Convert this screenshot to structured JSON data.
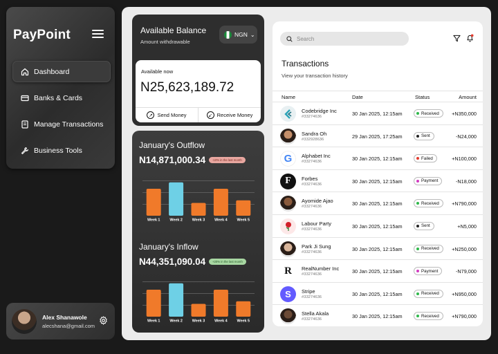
{
  "sidebar": {
    "brand": "PayPoint",
    "items": [
      {
        "label": "Dashboard",
        "icon": "home-icon"
      },
      {
        "label": "Banks & Cards",
        "icon": "card-icon"
      },
      {
        "label": "Manage Transactions",
        "icon": "receipt-icon"
      },
      {
        "label": "Business Tools",
        "icon": "wrench-icon"
      }
    ]
  },
  "profile": {
    "name": "Alex Shanawole",
    "email": "alecshana@gmail.com"
  },
  "balance": {
    "title": "Available Balance",
    "subtitle": "Amount withdrawable",
    "currency": "NGN",
    "available_label": "Available now",
    "amount": "N25,623,189.72",
    "send_label": "Send Money",
    "receive_label": "Receive Money"
  },
  "outflow": {
    "title": "January's Outflow",
    "amount": "N14,871,000.34",
    "badge": "-10% in the last month"
  },
  "inflow": {
    "title": "January's Inflow",
    "amount": "N44,351,090.04",
    "badge": "+20% in the last month"
  },
  "chart_data": [
    {
      "type": "bar",
      "categories": [
        "Week 1",
        "Week 2",
        "Week 3",
        "Week 4",
        "Week 5"
      ],
      "values": [
        42,
        52,
        20,
        42,
        24
      ],
      "highlight_index": 1,
      "colors": {
        "bar": "#f07a2a",
        "highlight": "#6ed0e6"
      }
    },
    {
      "type": "bar",
      "categories": [
        "Week 1",
        "Week 2",
        "Week 3",
        "Week 4",
        "Week 5"
      ],
      "values": [
        42,
        52,
        20,
        42,
        24
      ],
      "highlight_index": 1,
      "colors": {
        "bar": "#f07a2a",
        "highlight": "#6ed0e6"
      }
    }
  ],
  "transactions": {
    "search_placeholder": "Search",
    "title": "Transactions",
    "subtitle": "View your transaction history",
    "columns": [
      "Name",
      "Date",
      "Status",
      "Amount"
    ],
    "rows": [
      {
        "name": "Codebridge Inc",
        "id": "#33274636",
        "date": "30 Jan 2025, 12:15am",
        "status": "Received",
        "amount": "+N350,000",
        "logo": "codebridge-logo"
      },
      {
        "name": "Sandra Oh",
        "id": "#332928636",
        "date": "29 Jan 2025, 17:25am",
        "status": "Sent",
        "amount": "-N24,000",
        "logo": "avatar"
      },
      {
        "name": "Alphabet Inc",
        "id": "#33274636",
        "date": "30 Jan 2025, 12:15am",
        "status": "Failed",
        "amount": "+N100,000",
        "logo": "google-logo"
      },
      {
        "name": "Forbes",
        "id": "#33274636",
        "date": "30 Jan 2025, 12:15am",
        "status": "Payment",
        "amount": "-N18,000",
        "logo": "forbes-logo"
      },
      {
        "name": "Ayomide Ajao",
        "id": "#33274636",
        "date": "30 Jan 2025, 12:15am",
        "status": "Received",
        "amount": "+N790,000",
        "logo": "avatar"
      },
      {
        "name": "Labour Party",
        "id": "#33274636",
        "date": "30 Jan 2025, 12:15am",
        "status": "Sent",
        "amount": "+N5,000",
        "logo": "rose-logo"
      },
      {
        "name": "Park Ji Sung",
        "id": "#33274636",
        "date": "30 Jan 2025, 12:15am",
        "status": "Received",
        "amount": "+N250,000",
        "logo": "avatar"
      },
      {
        "name": "RealNumber Inc",
        "id": "#33274636",
        "date": "30 Jan 2025, 12:15am",
        "status": "Payment",
        "amount": "-N79,000",
        "logo": "realnumber-logo"
      },
      {
        "name": "Stripe",
        "id": "#33274636",
        "date": "30 Jan 2025, 12:15am",
        "status": "Received",
        "amount": "+N950,000",
        "logo": "stripe-logo"
      },
      {
        "name": "Stella Akala",
        "id": "#33274636",
        "date": "30 Jan 2025, 12:15am",
        "status": "Received",
        "amount": "+N790,000",
        "logo": "avatar"
      }
    ],
    "status_colors": {
      "Received": "#2eb84a",
      "Sent": "#222222",
      "Failed": "#e23a2e",
      "Payment": "#d23ac0"
    }
  }
}
